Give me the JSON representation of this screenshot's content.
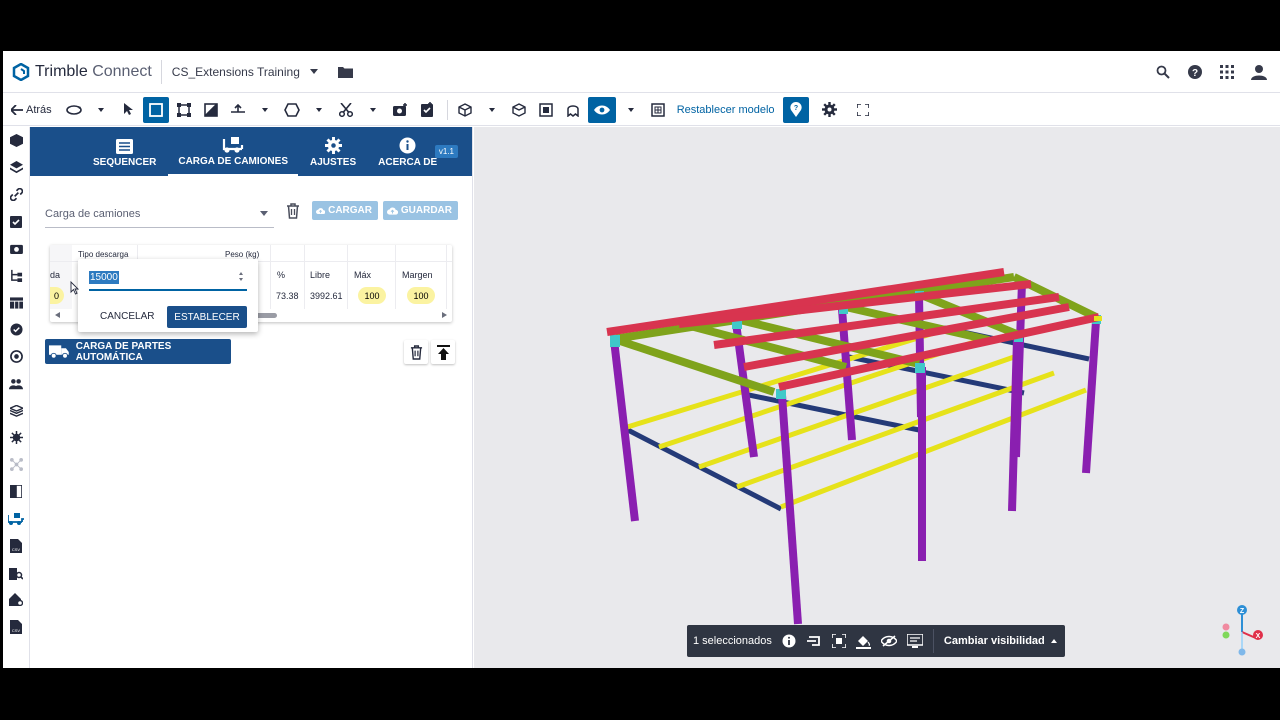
{
  "header": {
    "brand_first": "Trimble",
    "brand_second": "Connect",
    "project": "CS_Extensions Training",
    "icons": [
      "search-icon",
      "help-icon",
      "apps-grid-icon",
      "user-icon"
    ]
  },
  "toolbar": {
    "back_label": "Atrás",
    "reset_model": "Restablecer modelo"
  },
  "panel": {
    "tabs": [
      {
        "label": "SEQUENCER",
        "icon": "list-icon"
      },
      {
        "label": "CARGA DE CAMIONES",
        "icon": "truck-loading-icon"
      },
      {
        "label": "AJUSTES",
        "icon": "gear-icon"
      },
      {
        "label": "ACERCA DE",
        "icon": "info-icon"
      }
    ],
    "version": "v1.1",
    "selector_value": "Carga de camiones",
    "upload_label": "CARGAR",
    "save_label": "GUARDAR",
    "table": {
      "group_headers": [
        "Tipo descarga",
        "Peso (kg)"
      ],
      "partial_header": "da",
      "partial_value": "0",
      "columns": [
        "%",
        "Libre",
        "Máx",
        "Margen"
      ],
      "row": {
        "percent": "73.38",
        "free": "3992.61",
        "max": "100",
        "margin": "100"
      }
    },
    "popover": {
      "input_value": "15000",
      "cancel_label": "CANCELAR",
      "set_label": "ESTABLECER"
    },
    "auto_button_label": "CARGA DE PARTES AUTOMÁTICA"
  },
  "selection_bar": {
    "count_label": "1 seleccionados",
    "visibility_label": "Cambiar visibilidad"
  },
  "axes": {
    "z": "Z",
    "x": "X"
  },
  "colors": {
    "brand_blue": "#0063a3",
    "panel_navy": "#1a4f8a",
    "rafter_red": "#d8344f",
    "column_purple": "#8a1fb0",
    "purlin_green": "#7fa31b",
    "beam_yellow": "#e6e21a",
    "beam_navy": "#243a78"
  }
}
